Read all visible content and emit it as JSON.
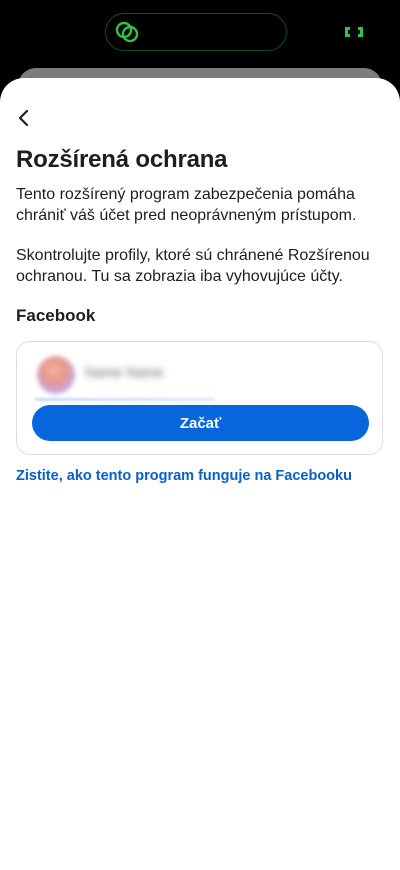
{
  "status_bar": {
    "island_icon": "link-rings-icon",
    "indicator_icon": "camera-indicator-icon",
    "accent_color": "#31c24a"
  },
  "header": {
    "back_icon": "chevron-left-icon"
  },
  "main": {
    "title": "Rozšírená ochrana",
    "description": "Tento rozšírený program zabezpečenia pomáha chrániť váš účet pred neoprávneným prístupom.",
    "instruction": "Skontrolujte profily, ktoré sú chránené Rozšírenou ochranou. Tu sa zobrazia iba vyhovujúce účty.",
    "section_title": "Facebook",
    "account": {
      "name": "Name Name"
    },
    "start_button_label": "Začať",
    "learn_more_link": "Zistite, ako tento program funguje na Facebooku"
  },
  "colors": {
    "primary_button": "#0866dd",
    "link": "#0a5fc8",
    "text": "#1c1e21",
    "card_border": "#dadde1"
  }
}
